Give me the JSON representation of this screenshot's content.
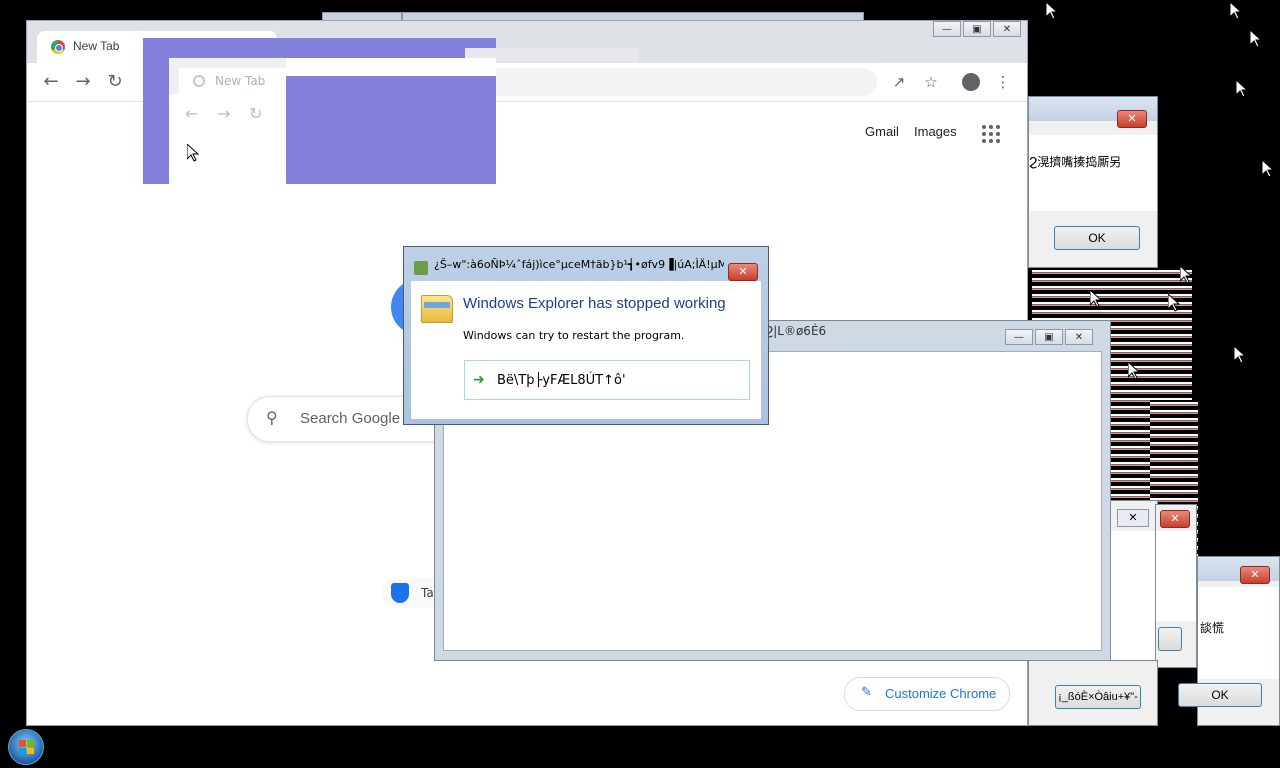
{
  "chrome": {
    "tab_title": "New Tab",
    "gmail": "Gmail",
    "images": "Images",
    "search_placeholder": "Search Google",
    "shortcut_label": "Ta",
    "customize_label": "Customize Chrome"
  },
  "ghost_chrome": {
    "tab_title": "New Tab"
  },
  "right_boxes": {
    "box1_text": "Ϩ滉擠嘴揍捣厮另",
    "box1_ok": "OK",
    "box3_text": "談慌",
    "box3_ok": "OK",
    "box4_btn": "¡_ßóÈ×Òâiu+¥\"-"
  },
  "big_window": {
    "title": "Ϩ|L®ø6É6"
  },
  "error_dialog": {
    "title": "¿Š–w\":à6oÑÞ¼ˆfáj)ìce°µceM†äb}b¹┪•øfv9▐|úA;ÌÄ!µMb...",
    "heading": "Windows Explorer has stopped working",
    "message": "Windows can try to restart the program.",
    "command": "Bë\\Tþ├yFÆL8ÚT↑ô'"
  },
  "colors": {
    "accent_purple": "#8580dc",
    "google_blue": "#1a73e8",
    "dialog_heading": "#1e3d8f"
  }
}
